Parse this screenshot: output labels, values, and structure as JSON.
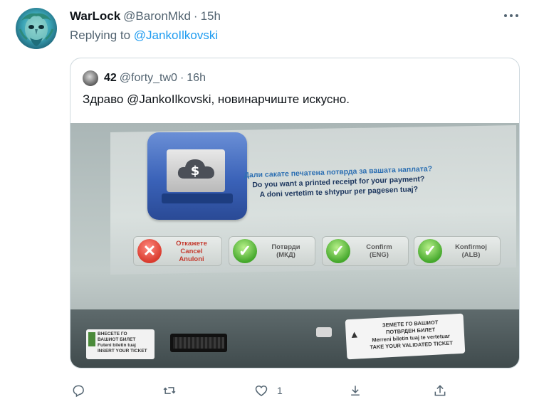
{
  "tweet": {
    "display_name": "WarLock",
    "handle": "@BaronMkd",
    "separator": "·",
    "time": "15h",
    "reply_prefix": "Replying to ",
    "reply_mention": "@JankoIlkovski"
  },
  "quoted": {
    "display_name": "42",
    "handle": "@forty_tw0",
    "separator": "·",
    "time": "16h",
    "text": "Здраво @JankoIlkovski, новинарчиште искусно.",
    "photo": {
      "prompt": [
        "Дали сакате печатена потврда за вашата наплата?",
        "Do you want a printed receipt for your payment?",
        "A doni vertetim te shtypur per pagesen tuaj?"
      ],
      "buttons": [
        {
          "line1": "Откажете",
          "line2": "Cancel",
          "line3": "Anuloni"
        },
        {
          "line1": "Потврди",
          "line2": "(МКД)"
        },
        {
          "line1": "Confirm",
          "line2": "(ENG)"
        },
        {
          "line1": "Konfirmoj",
          "line2": "(ALB)"
        }
      ],
      "left_label": [
        "ВНЕСЕТЕ ГО",
        "ВАШИОТ БИЛЕТ",
        "Futeni biletin tuaj",
        "INSERT YOUR TICKET"
      ],
      "right_label": [
        "ЗЕМЕТЕ ГО ВАШИОТ",
        "ПОТВРДЕН БИЛЕТ",
        "Merreni biletin tuaj te vertetuar",
        "TAKE YOUR VALIDATED TICKET"
      ]
    }
  },
  "actions": {
    "reply_icon": "reply-icon",
    "retweet_icon": "retweet-icon",
    "like_icon": "like-icon",
    "like_count": "1",
    "bookmark_icon": "bookmark-icon",
    "share_icon": "share-icon"
  },
  "colors": {
    "link": "#1d9bf0",
    "secondary_text": "#536471",
    "border": "#cfd9de"
  }
}
